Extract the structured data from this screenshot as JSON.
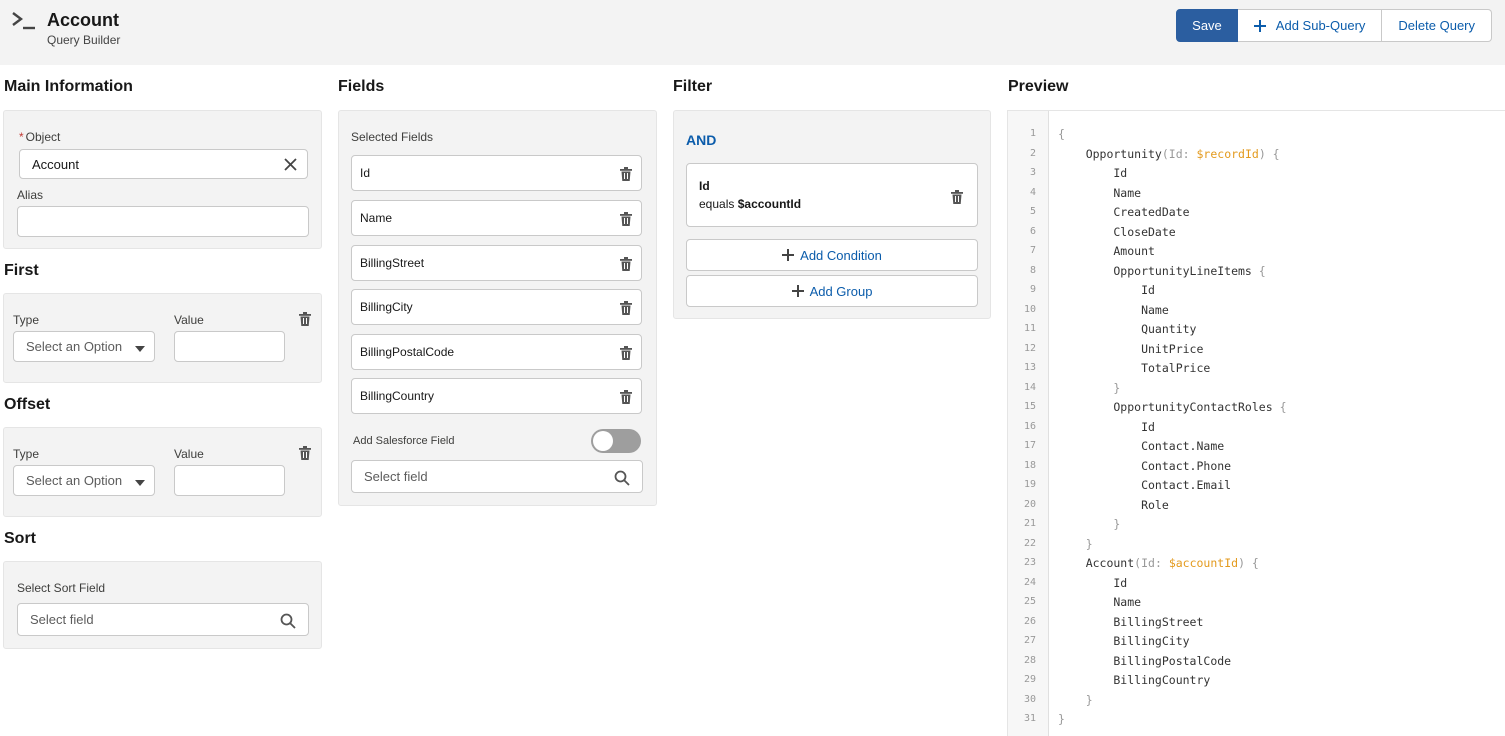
{
  "header": {
    "title": "Account",
    "subtitle": "Query Builder",
    "save_label": "Save",
    "add_subquery_label": "Add Sub-Query",
    "delete_query_label": "Delete Query"
  },
  "main_info": {
    "title": "Main Information",
    "object_label": "Object",
    "object_required_mark": "*",
    "object_value": "Account",
    "alias_label": "Alias",
    "alias_value": ""
  },
  "first": {
    "title": "First",
    "type_label": "Type",
    "type_value": "Select an Option",
    "value_label": "Value",
    "value_value": ""
  },
  "offset": {
    "title": "Offset",
    "type_label": "Type",
    "type_value": "Select an Option",
    "value_label": "Value",
    "value_value": ""
  },
  "sort": {
    "title": "Sort",
    "field_label": "Select Sort Field",
    "field_placeholder": "Select field"
  },
  "fields": {
    "title": "Fields",
    "selected_label": "Selected Fields",
    "items": [
      "Id",
      "Name",
      "BillingStreet",
      "BillingCity",
      "BillingPostalCode",
      "BillingCountry"
    ],
    "add_sf_label": "Add Salesforce Field",
    "add_sf_toggle_on": false,
    "select_placeholder": "Select field"
  },
  "filter": {
    "title": "Filter",
    "group_operator": "AND",
    "condition": {
      "field": "Id",
      "operator": "equals",
      "value": "$accountId"
    },
    "add_condition_label": "Add Condition",
    "add_group_label": "Add Group"
  },
  "preview": {
    "title": "Preview",
    "lines": [
      "{",
      "    Opportunity(Id: $recordId) {",
      "        Id",
      "        Name",
      "        CreatedDate",
      "        CloseDate",
      "        Amount",
      "        OpportunityLineItems {",
      "            Id",
      "            Name",
      "            Quantity",
      "            UnitPrice",
      "            TotalPrice",
      "        }",
      "        OpportunityContactRoles {",
      "            Id",
      "            Contact.Name",
      "            Contact.Phone",
      "            Contact.Email",
      "            Role",
      "        }",
      "    }",
      "    Account(Id: $accountId) {",
      "        Id",
      "        Name",
      "        BillingStreet",
      "        BillingCity",
      "        BillingPostalCode",
      "        BillingCountry",
      "    }",
      "}"
    ]
  },
  "icons": {
    "app": "terminal-icon",
    "clear": "close-icon",
    "delete": "trash-icon",
    "search": "search-icon",
    "dropdown": "chevron-down-icon",
    "add": "plus-icon"
  },
  "colors": {
    "brand": "#2b5ea0",
    "link": "#0b5cab",
    "variable": "#e39a1d",
    "required": "#c23934"
  }
}
